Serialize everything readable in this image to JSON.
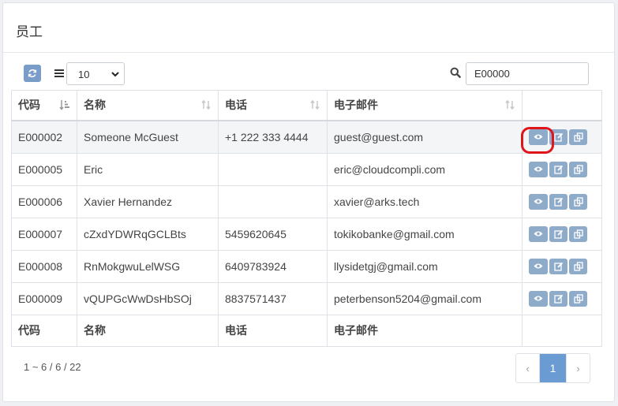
{
  "panel": {
    "title": "员工"
  },
  "toolbar": {
    "refresh_icon": "refresh-icon",
    "columns_icon": "menu-icon",
    "page_size": "10",
    "search_icon": "search-icon",
    "search_value": "E00000"
  },
  "table": {
    "headers": [
      "代码",
      "名称",
      "电话",
      "电子邮件"
    ],
    "rows": [
      {
        "code": "E000002",
        "name": "Someone McGuest",
        "phone": "+1 222 333 4444",
        "email": "guest@guest.com"
      },
      {
        "code": "E000005",
        "name": "Eric",
        "phone": "",
        "email": "eric@cloudcompli.com"
      },
      {
        "code": "E000006",
        "name": "Xavier Hernandez",
        "phone": "",
        "email": "xavier@arks.tech"
      },
      {
        "code": "E000007",
        "name": "cZxdYDWRqGCLBts",
        "phone": "5459620645",
        "email": "tokikobanke@gmail.com"
      },
      {
        "code": "E000008",
        "name": "RnMokgwuLelWSG",
        "phone": "6409783924",
        "email": "llysidetgj@gmail.com"
      },
      {
        "code": "E000009",
        "name": "vQUPGcWwDsHbSOj",
        "phone": "8837571437",
        "email": "peterbenson5204@gmail.com"
      }
    ],
    "footer": [
      "代码",
      "名称",
      "电话",
      "电子邮件"
    ],
    "row_actions": [
      "eye-icon",
      "edit-icon",
      "copy-icon"
    ]
  },
  "pagination": {
    "info": "1 ~ 6 / 6 / 22",
    "prev": "‹",
    "current": "1",
    "next": "›"
  },
  "colors": {
    "accent": "#6a9bd3",
    "action_button": "#8eabc9",
    "highlight": "#e0141b"
  }
}
